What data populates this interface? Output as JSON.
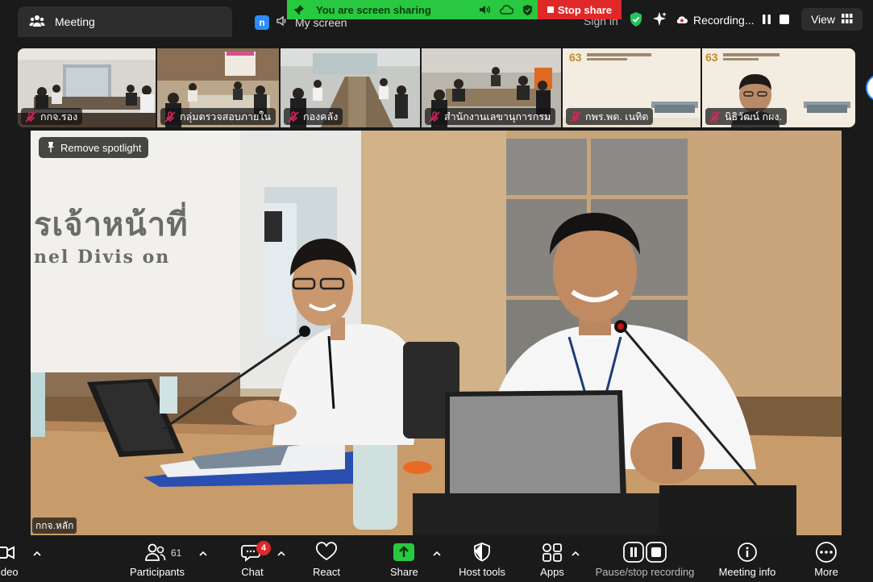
{
  "window": {
    "tab_title": "Meeting",
    "my_screen_badge": "n",
    "my_screen_label": "My screen",
    "share_banner_text": "You are screen sharing",
    "stop_share_label": "Stop share",
    "sign_in_label": "Sign in",
    "recording_label": "Recording...",
    "view_label": "View"
  },
  "thumbnails": [
    {
      "name": "กกจ.รอง",
      "muted": true
    },
    {
      "name": "กลุ่มตรวจสอบภายใน",
      "muted": true
    },
    {
      "name": "กองคลัง",
      "muted": true
    },
    {
      "name": "สำนักงานเลขานุการกรม",
      "muted": true
    },
    {
      "name": "กพร.พด. เนทิด",
      "muted": true
    },
    {
      "name": "นิธิวัฒน์ กผง.",
      "muted": true
    }
  ],
  "main_video": {
    "spotlight_label": "Remove spotlight",
    "participant_name": "กกจ.หลัก",
    "wall_text_line1": "รเจ้าหน้าที่",
    "wall_text_line2": "nel Divis on"
  },
  "toolbar": {
    "video_label": "ideo",
    "participants_label": "Participants",
    "participants_count": "61",
    "chat_label": "Chat",
    "chat_badge": "4",
    "react_label": "React",
    "share_label": "Share",
    "host_tools_label": "Host tools",
    "apps_label": "Apps",
    "recording_label": "Pause/stop recording",
    "meeting_info_label": "Meeting info",
    "more_label": "More"
  },
  "colors": {
    "share_green": "#28c840",
    "stop_red": "#e02828",
    "muted_red": "#e0245e",
    "shield_green": "#22c55e"
  }
}
